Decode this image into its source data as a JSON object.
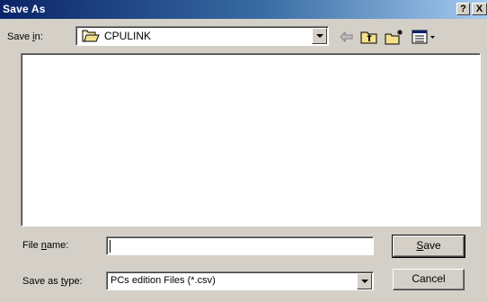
{
  "window": {
    "title": "Save As",
    "help_button": "?",
    "close_button": "X"
  },
  "save_in": {
    "label_pre": "Save ",
    "label_accel": "i",
    "label_post": "n:",
    "value": "CPULINK"
  },
  "toolbar": {
    "icons": [
      "back-arrow-icon",
      "up-one-level-icon",
      "create-new-folder-icon",
      "view-menu-icon"
    ]
  },
  "file_list": {
    "items": []
  },
  "file_name": {
    "label_pre": "File ",
    "label_accel": "n",
    "label_post": "ame:",
    "value": ""
  },
  "save_as_type": {
    "label_pre": "Save as ",
    "label_accel": "t",
    "label_post": "ype:",
    "value": "PCs edition Files (*.csv)"
  },
  "buttons": {
    "save_accel": "S",
    "save_rest": "ave",
    "cancel": "Cancel"
  },
  "colors": {
    "title_bar_start": "#0a246a",
    "title_bar_end": "#a6caf0",
    "dialog_face": "#d4d0c8",
    "folder_yellow": "#f4e08a"
  }
}
